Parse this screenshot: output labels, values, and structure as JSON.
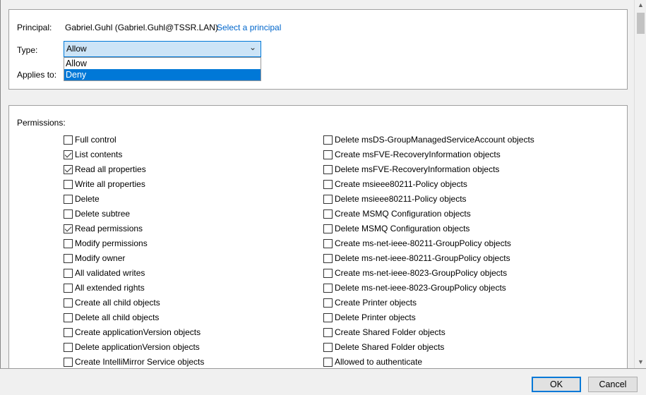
{
  "principal": {
    "label": "Principal:",
    "value": "Gabriel.Guhl (Gabriel.Guhl@TSSR.LAN)",
    "link": "Select a principal"
  },
  "type": {
    "label": "Type:",
    "value": "Allow",
    "options": [
      "Allow",
      "Deny"
    ],
    "highlighted": "Deny"
  },
  "applies_to": {
    "label": "Applies to:"
  },
  "permissions": {
    "label": "Permissions:",
    "left": [
      {
        "label": "Full control",
        "checked": false
      },
      {
        "label": "List contents",
        "checked": true
      },
      {
        "label": "Read all properties",
        "checked": true
      },
      {
        "label": "Write all properties",
        "checked": false
      },
      {
        "label": "Delete",
        "checked": false
      },
      {
        "label": "Delete subtree",
        "checked": false
      },
      {
        "label": "Read permissions",
        "checked": true
      },
      {
        "label": "Modify permissions",
        "checked": false
      },
      {
        "label": "Modify owner",
        "checked": false
      },
      {
        "label": "All validated writes",
        "checked": false
      },
      {
        "label": "All extended rights",
        "checked": false
      },
      {
        "label": "Create all child objects",
        "checked": false
      },
      {
        "label": "Delete all child objects",
        "checked": false
      },
      {
        "label": "Create applicationVersion objects",
        "checked": false
      },
      {
        "label": "Delete applicationVersion objects",
        "checked": false
      },
      {
        "label": "Create IntelliMirror Service objects",
        "checked": false
      }
    ],
    "right": [
      {
        "label": "Delete msDS-GroupManagedServiceAccount objects",
        "checked": false
      },
      {
        "label": "Create msFVE-RecoveryInformation objects",
        "checked": false
      },
      {
        "label": "Delete msFVE-RecoveryInformation objects",
        "checked": false
      },
      {
        "label": "Create msieee80211-Policy objects",
        "checked": false
      },
      {
        "label": "Delete msieee80211-Policy objects",
        "checked": false
      },
      {
        "label": "Create MSMQ Configuration objects",
        "checked": false
      },
      {
        "label": "Delete MSMQ Configuration objects",
        "checked": false
      },
      {
        "label": "Create ms-net-ieee-80211-GroupPolicy objects",
        "checked": false
      },
      {
        "label": "Delete ms-net-ieee-80211-GroupPolicy objects",
        "checked": false
      },
      {
        "label": "Create ms-net-ieee-8023-GroupPolicy objects",
        "checked": false
      },
      {
        "label": "Delete ms-net-ieee-8023-GroupPolicy objects",
        "checked": false
      },
      {
        "label": "Create Printer objects",
        "checked": false
      },
      {
        "label": "Delete Printer objects",
        "checked": false
      },
      {
        "label": "Create Shared Folder objects",
        "checked": false
      },
      {
        "label": "Delete Shared Folder objects",
        "checked": false
      },
      {
        "label": "Allowed to authenticate",
        "checked": false
      }
    ]
  },
  "buttons": {
    "ok": "OK",
    "cancel": "Cancel"
  }
}
